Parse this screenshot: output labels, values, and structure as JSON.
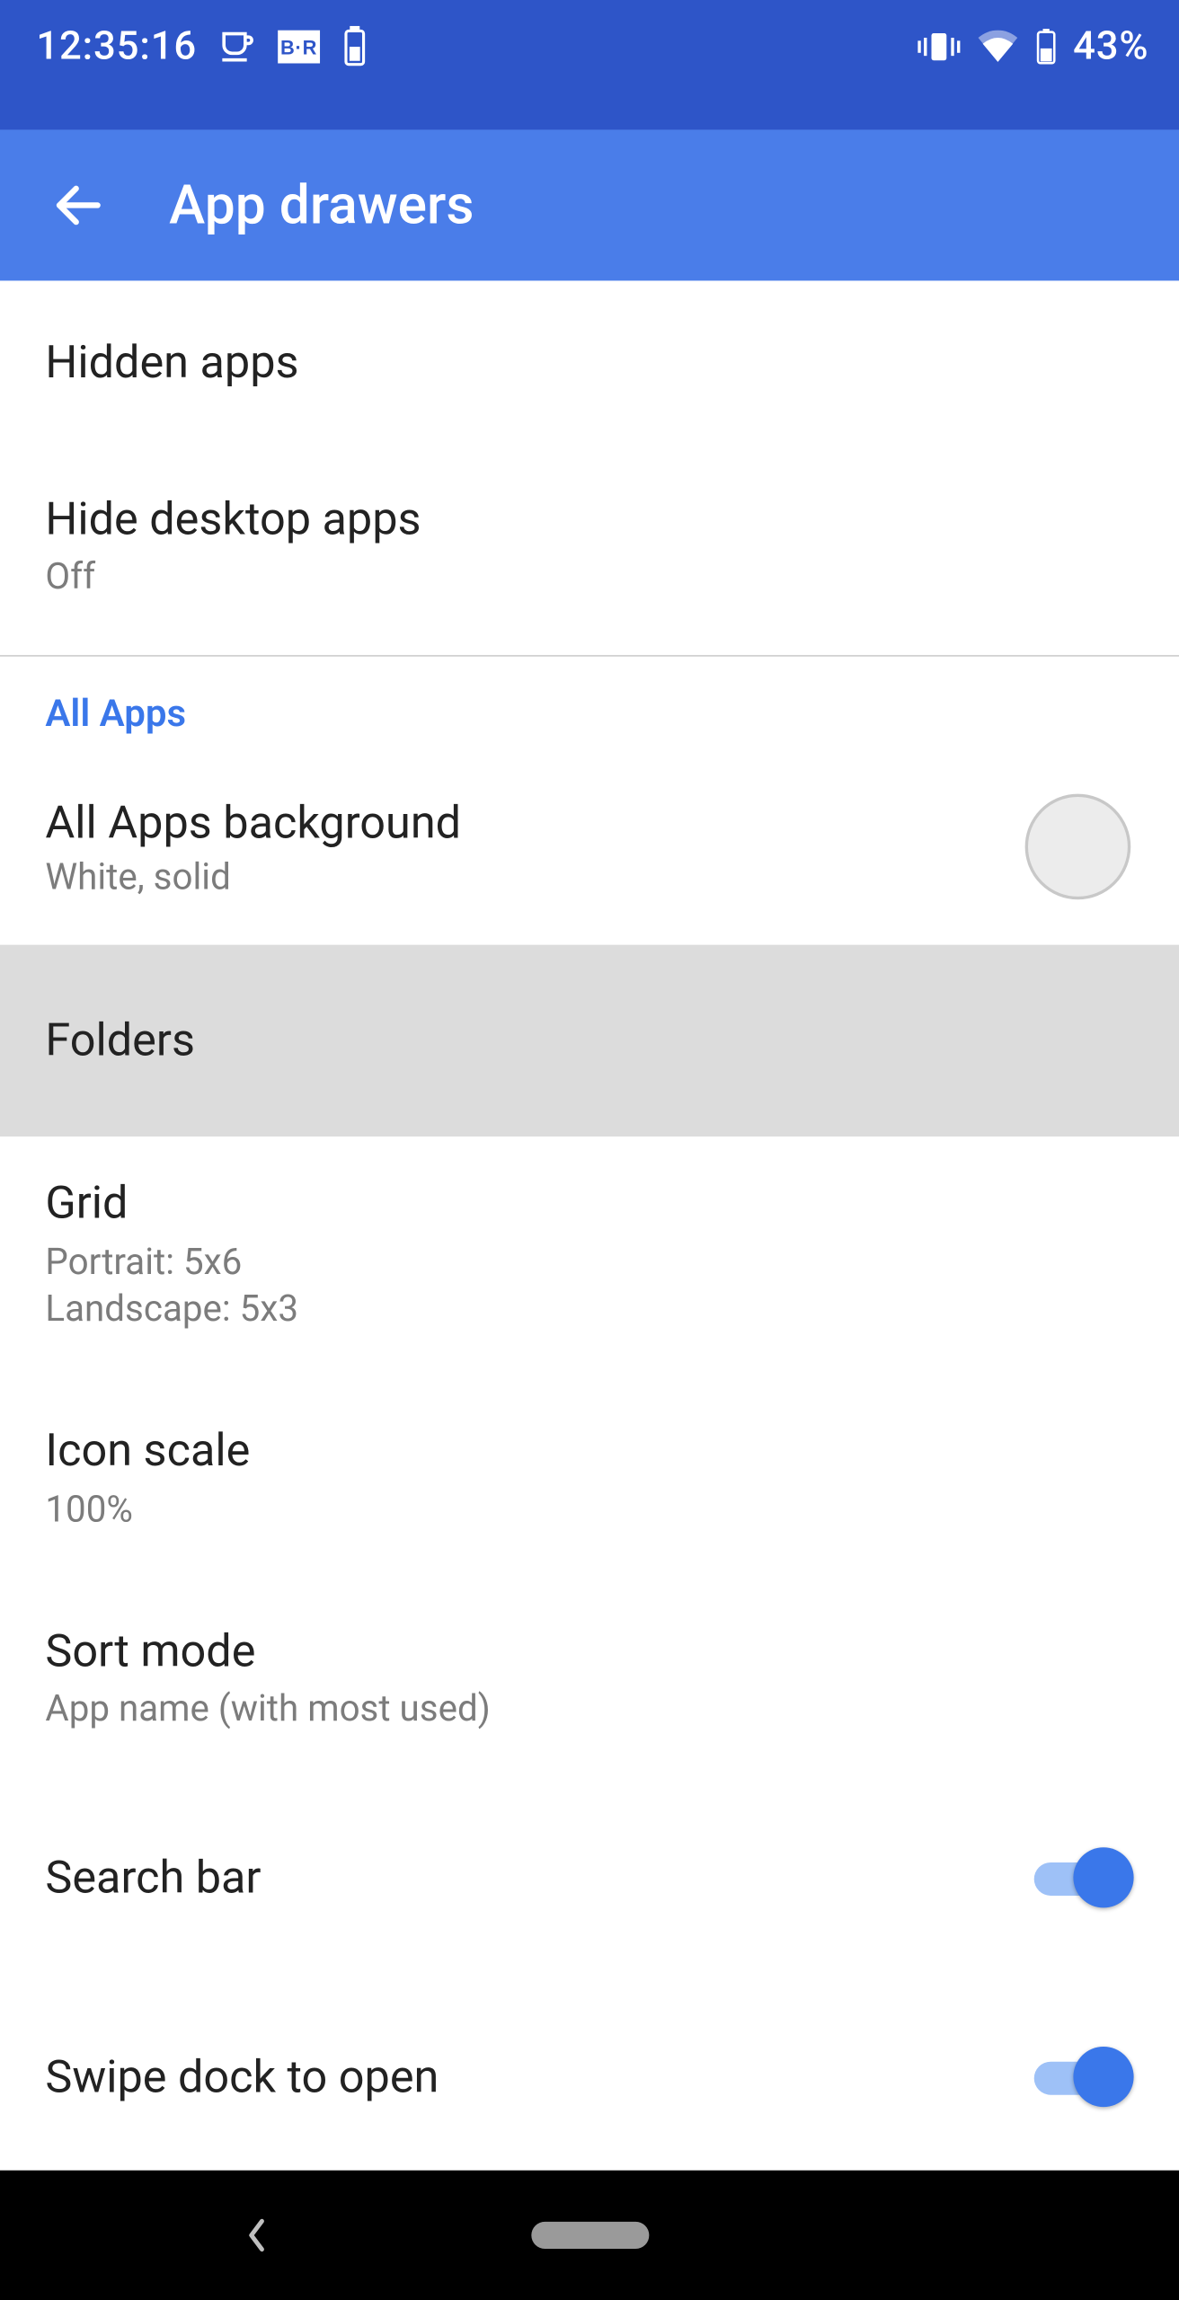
{
  "status": {
    "time": "12:35:16",
    "battery_percent": "43%"
  },
  "header": {
    "title": "App drawers"
  },
  "items": {
    "hidden_apps": {
      "title": "Hidden apps"
    },
    "hide_desktop": {
      "title": "Hide desktop apps",
      "sub": "Off"
    },
    "section_all_apps": "All Apps",
    "all_apps_bg": {
      "title": "All Apps background",
      "sub": "White, solid"
    },
    "folders": {
      "title": "Folders"
    },
    "grid": {
      "title": "Grid",
      "sub1": "Portrait: 5x6",
      "sub2": "Landscape: 5x3"
    },
    "icon_scale": {
      "title": "Icon scale",
      "sub": "100%"
    },
    "sort_mode": {
      "title": "Sort mode",
      "sub": "App name (with most used)"
    },
    "search_bar": {
      "title": "Search bar",
      "on": true
    },
    "swipe_dock": {
      "title": "Swipe dock to open",
      "on": true
    }
  }
}
